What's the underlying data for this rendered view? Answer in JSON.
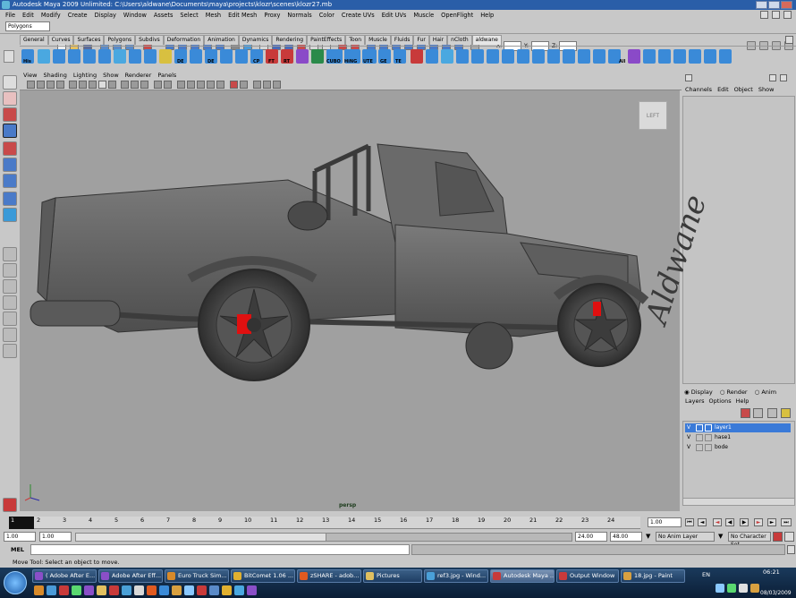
{
  "window": {
    "title": "Autodesk Maya 2009 Unlimited: C:\\Users\\aldwane\\Documents\\maya\\projects\\klozr\\scenes\\klozr27.mb"
  },
  "menubar": [
    "File",
    "Edit",
    "Modify",
    "Create",
    "Display",
    "Window",
    "Assets",
    "Select",
    "Mesh",
    "Edit Mesh",
    "Proxy",
    "Normals",
    "Color",
    "Create UVs",
    "Edit UVs",
    "Muscle",
    "OpenFlight",
    "Help"
  ],
  "statusline": {
    "mode": "Polygons",
    "x_label": "X:",
    "y_label": "Y:",
    "z_label": "Z:"
  },
  "shelf_tabs": [
    "General",
    "Curves",
    "Surfaces",
    "Polygons",
    "Subdivs",
    "Deformation",
    "Animation",
    "Dynamics",
    "Rendering",
    "PaintEffects",
    "Toon",
    "Muscle",
    "Fluids",
    "Fur",
    "Hair",
    "nCloth",
    "aldwane"
  ],
  "shelf_active": "aldwane",
  "shelf_labels": [
    "His",
    "DE",
    "DE",
    "CP",
    "FT",
    "RT",
    "CUBO",
    "HiNG",
    "UTE",
    "GE",
    "TE",
    "All"
  ],
  "panel_menu": [
    "View",
    "Shading",
    "Lighting",
    "Show",
    "Renderer",
    "Panels"
  ],
  "viewport": {
    "camera_label": "persp",
    "viewcube_label": "LEFT",
    "watermark": "Aldwane"
  },
  "channel_box": {
    "menu": [
      "Channels",
      "Edit",
      "Object",
      "Show"
    ]
  },
  "layer_editor": {
    "modes": [
      "Display",
      "Render",
      "Anim"
    ],
    "menu": [
      "Layers",
      "Options",
      "Help"
    ],
    "layers": [
      {
        "vis": "V",
        "name": "layer1",
        "selected": true
      },
      {
        "vis": "V",
        "name": "hase1",
        "selected": false
      },
      {
        "vis": "V",
        "name": "bode",
        "selected": false
      }
    ]
  },
  "time_slider": {
    "ticks": [
      "1",
      "2",
      "3",
      "4",
      "5",
      "6",
      "7",
      "8",
      "9",
      "10",
      "11",
      "12",
      "13",
      "14",
      "15",
      "16",
      "17",
      "18",
      "19",
      "20",
      "21",
      "22",
      "23",
      "24"
    ],
    "current_frame": "1.00",
    "current_marker": "1"
  },
  "range_slider": {
    "start": "1.00",
    "inner_start": "1.00",
    "inner_end": "24.00",
    "end": "48.00",
    "anim_layer": "No Anim Layer",
    "character_set": "No Character Set"
  },
  "command_line": {
    "label": "MEL"
  },
  "help_line": "Move Tool: Select an object to move.",
  "taskbar": {
    "tasks": [
      {
        "label": "( Adobe After E...",
        "color": "#8a4fc8"
      },
      {
        "label": "Adobe After Eff...",
        "color": "#8a4fc8"
      },
      {
        "label": "Euro Truck Sim...",
        "color": "#d88a2a"
      },
      {
        "label": "BitComet 1.06 ...",
        "color": "#e0b030"
      },
      {
        "label": "zSHARE - adob...",
        "color": "#e05a20"
      },
      {
        "label": "Pictures",
        "color": "#e0c060"
      },
      {
        "label": "ref3.jpg - Wind...",
        "color": "#4aa0d8"
      },
      {
        "label": "Autodesk Maya ...",
        "color": "#c83a3a",
        "active": true
      },
      {
        "label": "Output Window",
        "color": "#c83a3a"
      },
      {
        "label": "18.jpg - Paint",
        "color": "#d8a040"
      }
    ],
    "language": "EN",
    "time": "06:21",
    "date": "08/03/2009"
  }
}
